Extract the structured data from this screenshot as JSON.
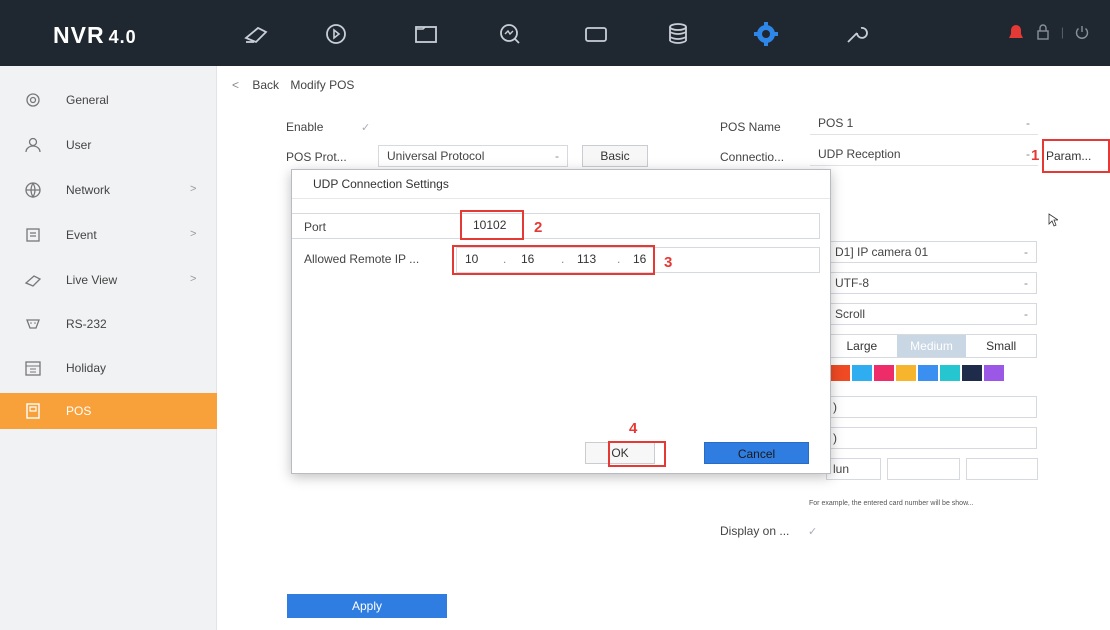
{
  "app": {
    "name": "NVR",
    "version": "4.0"
  },
  "top_icons": [
    "live-view-icon",
    "playback-icon",
    "file-icon",
    "search-icon",
    "monitor-icon",
    "storage-icon",
    "settings-icon",
    "maintenance-icon"
  ],
  "sidebar": {
    "items": [
      {
        "label": "General",
        "icon": "gear-icon",
        "chevron": ""
      },
      {
        "label": "User",
        "icon": "user-icon",
        "chevron": ""
      },
      {
        "label": "Network",
        "icon": "globe-icon",
        "chevron": ">"
      },
      {
        "label": "Event",
        "icon": "event-icon",
        "chevron": ">"
      },
      {
        "label": "Live View",
        "icon": "camera-icon",
        "chevron": ">"
      },
      {
        "label": "RS-232",
        "icon": "rs232-icon",
        "chevron": ""
      },
      {
        "label": "Holiday",
        "icon": "calendar-icon",
        "chevron": ""
      },
      {
        "label": "POS",
        "icon": "pos-icon",
        "chevron": ""
      }
    ]
  },
  "breadcrumb": {
    "back": "Back",
    "current": "Modify POS"
  },
  "form": {
    "enable_label": "Enable",
    "pos_protocol_label": "POS Prot...",
    "pos_protocol_value": "Universal Protocol",
    "basic_button": "Basic",
    "pos_name_label": "POS Name",
    "pos_name_value": "POS 1",
    "connection_label": "Connectio...",
    "connection_value": "UDP Reception",
    "param_button": "Param...",
    "camera_value": "D1] IP camera 01",
    "encoding_value": "UTF-8",
    "overlay_mode_value": "Scroll",
    "sizes": [
      "Large",
      "Medium",
      "Small"
    ],
    "colors": [
      "#f04a24",
      "#2eaef0",
      "#ee2c6a",
      "#f6b52c",
      "#3b8ff0",
      "#26c6d0",
      "#1f2b4a",
      "#9b58e6"
    ],
    "partial_text_1": ")",
    "partial_text_2": ")",
    "partial_text_3": "lun",
    "hint": "For example, the entered card number will be show...",
    "display_on_label": "Display on ...",
    "apply_button": "Apply"
  },
  "dialog": {
    "title": "UDP Connection Settings",
    "port_label": "Port",
    "port_value": "10102",
    "allowed_ip_label": "Allowed Remote IP ...",
    "ip_segments": [
      "10",
      "16",
      "113",
      "16"
    ],
    "ok_button": "OK",
    "cancel_button": "Cancel"
  },
  "annotations": [
    "1",
    "2",
    "3",
    "4"
  ]
}
